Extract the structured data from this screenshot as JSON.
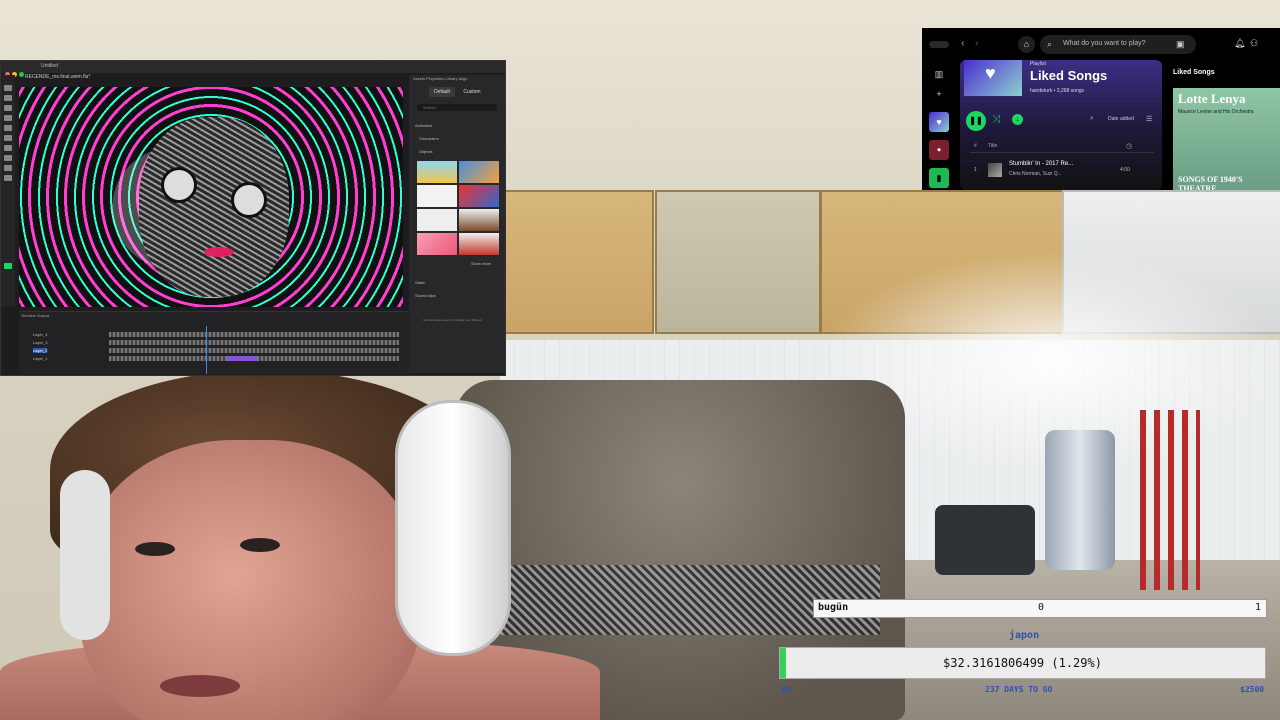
{
  "animate": {
    "window_title": "Untitled",
    "file_name": "RECENDE_ms.final.anim.fla*",
    "scene_label": "Scene 1",
    "zoom": "75%",
    "panel_tabs": "Assets  Properties  Library  Align",
    "segment_default": "Default",
    "segment_custom": "Custom",
    "search_placeholder": "Search",
    "section_animated": "Animated",
    "dropdown_characters": "Characters",
    "dropdown_objects": "Objects",
    "show_more": "Show more",
    "section_static": "Static",
    "section_sound": "Sound clips",
    "panel_footer": "Get the latest assets by visiting: Get Started",
    "timeline_label": "Timeline  Output",
    "layers": [
      "Layer_4",
      "Layer_3",
      "Layer_2",
      "Layer_1"
    ]
  },
  "spotify": {
    "search_placeholder": "What do you want to play?",
    "playlist_type": "Playlist",
    "playlist_name": "Liked Songs",
    "playlist_meta": "handeturk • 3,268 songs",
    "sort_label": "Date added",
    "col_hash": "#",
    "col_title": "Title",
    "track": {
      "number": "1",
      "title": "Stumblin' In - 2017 Re...",
      "artist": "Chris Norman, Suzi Q...",
      "duration": "4:00"
    },
    "right_panel_title": "Liked Songs",
    "now_playing_art_title": "Lotte Lenya",
    "now_playing_art_sub": "Maurice Levine and His Orchestra",
    "now_playing_art_footer": "SONGS OF 1940'S THEATRE",
    "accent_color": "#1ed760"
  },
  "overlay": {
    "today_label": "bugün",
    "today_mid": "0",
    "today_right": "1",
    "goal_name": "japon",
    "amount": "$32.3161806499 (1.29%)",
    "progress_percent": 1.29,
    "start_value": "$0",
    "days_to_go": "237 DAYS TO GO",
    "goal_value": "$2500",
    "progress_color": "#34d058",
    "label_color": "#2b4fbf"
  }
}
